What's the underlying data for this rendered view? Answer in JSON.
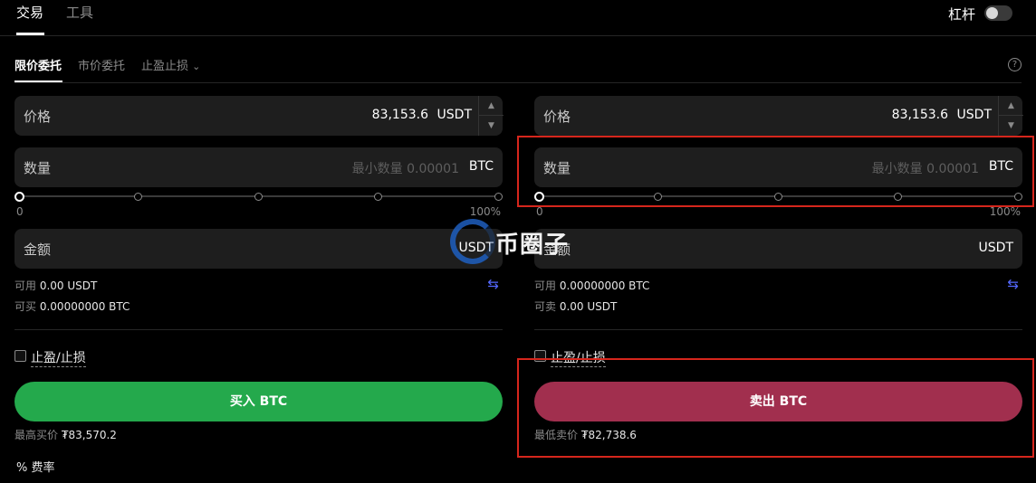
{
  "header": {
    "tabs": [
      {
        "label": "交易"
      },
      {
        "label": "工具"
      }
    ],
    "leverage_label": "杠杆"
  },
  "order_tabs": {
    "limit": "限价委托",
    "market": "市价委托",
    "tpsl": "止盈止损",
    "help": "?"
  },
  "buy": {
    "price_label": "价格",
    "price_value": "83,153.6",
    "price_unit": "USDT",
    "qty_label": "数量",
    "qty_placeholder": "最小数量 0.00001",
    "qty_unit": "BTC",
    "slider_min": "0",
    "slider_max": "100%",
    "slider_value_percent": 0,
    "amount_label": "金额",
    "amount_unit": "USDT",
    "available_label": "可用",
    "available_value": "0.00 USDT",
    "can_label": "可买",
    "can_value": "0.00000000 BTC",
    "tpsl_label": "止盈/止损",
    "button_label": "买入 BTC",
    "best_label": "最高买价",
    "best_value": "₮83,570.2"
  },
  "sell": {
    "price_label": "价格",
    "price_value": "83,153.6",
    "price_unit": "USDT",
    "qty_label": "数量",
    "qty_placeholder": "最小数量 0.00001",
    "qty_unit": "BTC",
    "slider_min": "0",
    "slider_max": "100%",
    "slider_value_percent": 0,
    "amount_label": "金额",
    "amount_unit": "USDT",
    "available_label": "可用",
    "available_value": "0.00000000 BTC",
    "can_label": "可卖",
    "can_value": "0.00 USDT",
    "tpsl_label": "止盈/止损",
    "button_label": "卖出 BTC",
    "best_label": "最低卖价",
    "best_value": "₮82,738.6"
  },
  "fee": {
    "icon": "%",
    "label": "费率"
  },
  "watermark": {
    "text": "币圈子"
  },
  "colors": {
    "buy": "#24a94c",
    "sell": "#a12f4e",
    "highlight": "#d6261c",
    "swap": "#5468ff"
  }
}
